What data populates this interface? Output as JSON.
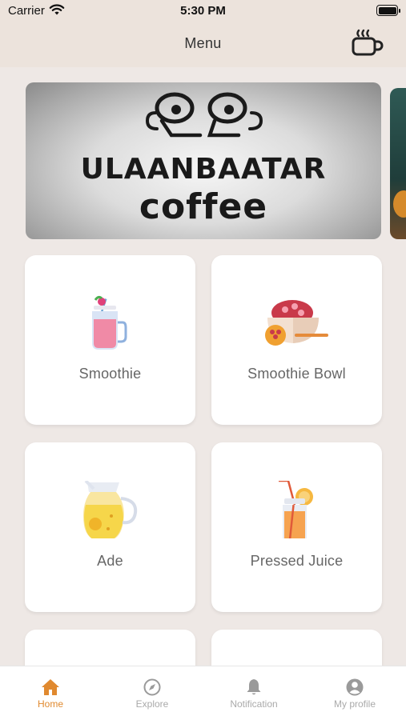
{
  "status_bar": {
    "carrier": "Carrier",
    "time": "5:30 PM"
  },
  "header": {
    "title": "Menu",
    "action_icon": "coffee-cup-icon"
  },
  "banner": {
    "brand_line1": "ULAANBAATAR",
    "brand_line2": "coffee"
  },
  "menu": {
    "items": [
      {
        "label": "Smoothie",
        "icon": "smoothie-jar-icon"
      },
      {
        "label": "Smoothie Bowl",
        "icon": "smoothie-bowl-icon"
      },
      {
        "label": "Ade",
        "icon": "lemonade-pitcher-icon"
      },
      {
        "label": "Pressed Juice",
        "icon": "juice-bottle-icon"
      }
    ]
  },
  "tabs": [
    {
      "label": "Home",
      "icon": "home-icon",
      "active": true
    },
    {
      "label": "Explore",
      "icon": "compass-icon",
      "active": false
    },
    {
      "label": "Notification",
      "icon": "bell-icon",
      "active": false
    },
    {
      "label": "My profile",
      "icon": "user-circle-icon",
      "active": false
    }
  ],
  "colors": {
    "accent": "#e0892f",
    "background": "#eee8e5",
    "header": "#ece3dc"
  }
}
